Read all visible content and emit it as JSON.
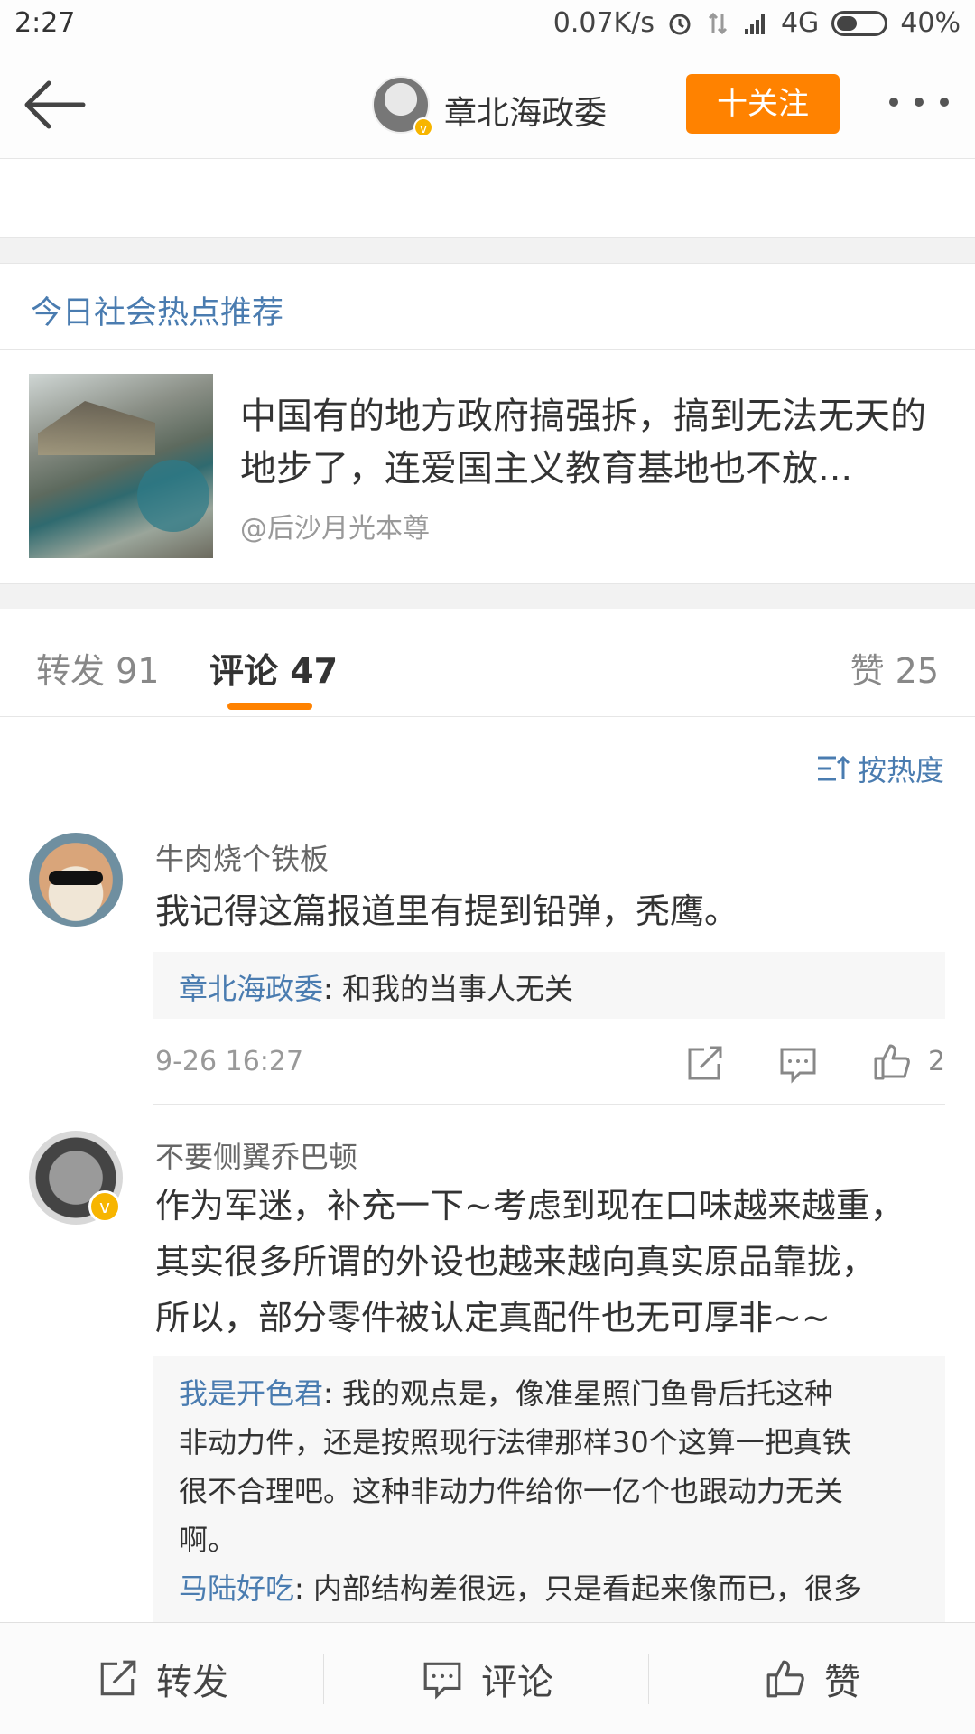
{
  "status_bar": {
    "time": "2:27",
    "speed": "0.07K/s",
    "network": "4G",
    "battery": "40%"
  },
  "header": {
    "name": "章北海政委",
    "follow_label": "十关注"
  },
  "hot": {
    "title": "今日社会热点推荐",
    "text": "中国有的地方政府搞强拆，搞到无法无天的地步了，连爱国主义教育基地也不放...",
    "source": "@后沙月光本尊"
  },
  "tabs": {
    "repost": "转发 91",
    "comment": "评论 47",
    "like": "赞 25"
  },
  "sort_label": "按热度",
  "comments": [
    {
      "name": "牛肉烧个铁板",
      "text": "我记得这篇报道里有提到铅弹，秃鹰。",
      "replies": [
        {
          "user": "章北海政委",
          "text": ": 和我的当事人无关"
        }
      ],
      "time": "9-26 16:27",
      "likes": "2"
    },
    {
      "name": "不要侧翼乔巴顿",
      "text_lines": [
        "作为军迷，补充一下~考虑到现在口味越来越重，",
        "其实很多所谓的外设也越来越向真实原品靠拢，",
        "所以，部分零件被认定真配件也无可厚非~~"
      ],
      "replies": [
        {
          "user": "我是开色君",
          "text_lines": [
            ": 我的观点是，像准星照门鱼骨后托这种",
            "非动力件，还是按照现行法律那样30个这算一把真铁",
            "很不合理吧。这种非动力件给你一亿个也跟动力无关",
            "啊。"
          ]
        },
        {
          "user": "马陆好吃",
          "text": ": 内部结构差很远，只是看起来像而已，很多"
        }
      ]
    }
  ],
  "bottom_bar": {
    "repost": "转发",
    "comment": "评论",
    "like": "赞"
  },
  "colors": {
    "accent": "#ff8200",
    "link": "#4a7cb0",
    "verified": "#f7b500"
  }
}
